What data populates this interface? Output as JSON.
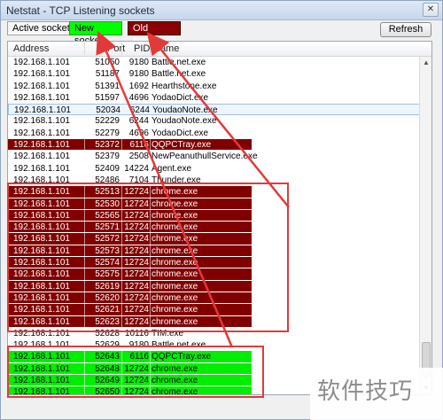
{
  "window": {
    "title": "Netstat - TCP Listening sockets",
    "close_glyph": "✕"
  },
  "toolbar": {
    "legend_active": "Active socket",
    "legend_new": "New socket",
    "legend_old": "Old socket",
    "refresh_label": "Refresh"
  },
  "columns": {
    "address": "Address",
    "port": "Port",
    "pid": "PID",
    "name": "Name"
  },
  "rows": [
    {
      "address": "192.168.1.101",
      "port": "51050",
      "pid": "9180",
      "name": "Battle.net.exe",
      "state": "active"
    },
    {
      "address": "192.168.1.101",
      "port": "51187",
      "pid": "9180",
      "name": "Battle.net.exe",
      "state": "active"
    },
    {
      "address": "192.168.1.101",
      "port": "51391",
      "pid": "1692",
      "name": "Hearthstone.exe",
      "state": "active"
    },
    {
      "address": "192.168.1.101",
      "port": "51597",
      "pid": "4696",
      "name": "YodaoDict.exe",
      "state": "active"
    },
    {
      "address": "192.168.1.101",
      "port": "52034",
      "pid": "6244",
      "name": "YoudaoNote.exe",
      "state": "selected"
    },
    {
      "address": "192.168.1.101",
      "port": "52229",
      "pid": "6244",
      "name": "YoudaoNote.exe",
      "state": "active"
    },
    {
      "address": "192.168.1.101",
      "port": "52279",
      "pid": "4696",
      "name": "YodaoDict.exe",
      "state": "active"
    },
    {
      "address": "192.168.1.101",
      "port": "52372",
      "pid": "6116",
      "name": "QQPCTray.exe",
      "state": "old"
    },
    {
      "address": "192.168.1.101",
      "port": "52379",
      "pid": "2508",
      "name": "NewPeanuthullService.exe",
      "state": "active"
    },
    {
      "address": "192.168.1.101",
      "port": "52409",
      "pid": "14224",
      "name": "Agent.exe",
      "state": "active"
    },
    {
      "address": "192.168.1.101",
      "port": "52486",
      "pid": "7104",
      "name": "Thunder.exe",
      "state": "active"
    },
    {
      "address": "192.168.1.101",
      "port": "52513",
      "pid": "12724",
      "name": "chrome.exe",
      "state": "old"
    },
    {
      "address": "192.168.1.101",
      "port": "52530",
      "pid": "12724",
      "name": "chrome.exe",
      "state": "old"
    },
    {
      "address": "192.168.1.101",
      "port": "52565",
      "pid": "12724",
      "name": "chrome.exe",
      "state": "old"
    },
    {
      "address": "192.168.1.101",
      "port": "52571",
      "pid": "12724",
      "name": "chrome.exe",
      "state": "old"
    },
    {
      "address": "192.168.1.101",
      "port": "52572",
      "pid": "12724",
      "name": "chrome.exe",
      "state": "old"
    },
    {
      "address": "192.168.1.101",
      "port": "52573",
      "pid": "12724",
      "name": "chrome.exe",
      "state": "old"
    },
    {
      "address": "192.168.1.101",
      "port": "52574",
      "pid": "12724",
      "name": "chrome.exe",
      "state": "old"
    },
    {
      "address": "192.168.1.101",
      "port": "52575",
      "pid": "12724",
      "name": "chrome.exe",
      "state": "old"
    },
    {
      "address": "192.168.1.101",
      "port": "52619",
      "pid": "12724",
      "name": "chrome.exe",
      "state": "old"
    },
    {
      "address": "192.168.1.101",
      "port": "52620",
      "pid": "12724",
      "name": "chrome.exe",
      "state": "old"
    },
    {
      "address": "192.168.1.101",
      "port": "52621",
      "pid": "12724",
      "name": "chrome.exe",
      "state": "old"
    },
    {
      "address": "192.168.1.101",
      "port": "52623",
      "pid": "12724",
      "name": "chrome.exe",
      "state": "old"
    },
    {
      "address": "192.168.1.101",
      "port": "52628",
      "pid": "10116",
      "name": "TIM.exe",
      "state": "active"
    },
    {
      "address": "192.168.1.101",
      "port": "52629",
      "pid": "9180",
      "name": "Battle.net.exe",
      "state": "active"
    },
    {
      "address": "192.168.1.101",
      "port": "52643",
      "pid": "6116",
      "name": "QQPCTray.exe",
      "state": "new"
    },
    {
      "address": "192.168.1.101",
      "port": "52648",
      "pid": "12724",
      "name": "chrome.exe",
      "state": "new"
    },
    {
      "address": "192.168.1.101",
      "port": "52649",
      "pid": "12724",
      "name": "chrome.exe",
      "state": "new"
    },
    {
      "address": "192.168.1.101",
      "port": "52650",
      "pid": "12724",
      "name": "chrome.exe",
      "state": "new"
    }
  ],
  "colors": {
    "old_socket": "#800000",
    "new_socket": "#00ee00",
    "annotation": "#e23a3a"
  },
  "watermark": "软件技巧"
}
